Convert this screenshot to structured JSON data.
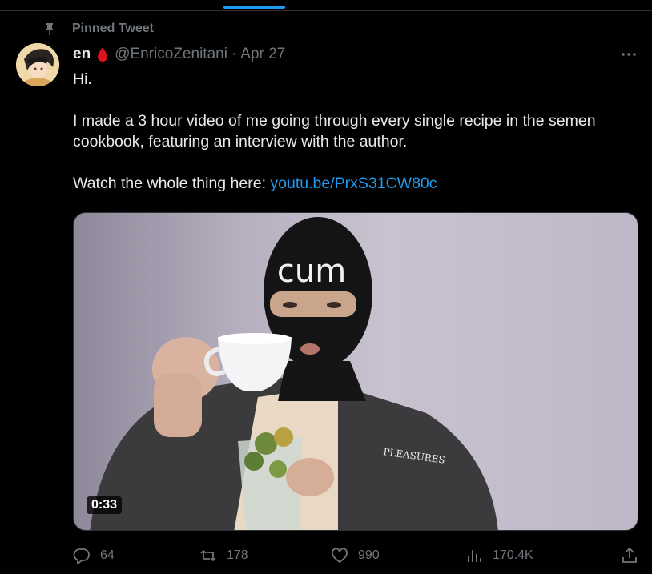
{
  "pinned_label": "Pinned Tweet",
  "author": {
    "display_name": "en",
    "handle": "@EnricoZenitani",
    "separator": "·",
    "date": "Apr 27"
  },
  "tweet": {
    "line1": "Hi.",
    "line2": "I made a 3 hour video of me going through every single recipe in the semen cookbook, featuring an interview with the author.",
    "line3_prefix": "Watch the whole thing here: ",
    "link_text": "youtu.be/PrxS31CW80c"
  },
  "media": {
    "mask_text": "cum",
    "shirt_text": "PLEASURES",
    "duration": "0:33"
  },
  "actions": {
    "replies": "64",
    "retweets": "178",
    "likes": "990",
    "views": "170.4K"
  },
  "colors": {
    "accent": "#1d9bf0",
    "muted": "#71767b",
    "text": "#e7e9ea",
    "background": "#000000"
  },
  "icons": [
    "pin-icon",
    "blood-drop-icon",
    "more-icon",
    "reply-icon",
    "retweet-icon",
    "like-icon",
    "views-icon",
    "share-icon"
  ]
}
